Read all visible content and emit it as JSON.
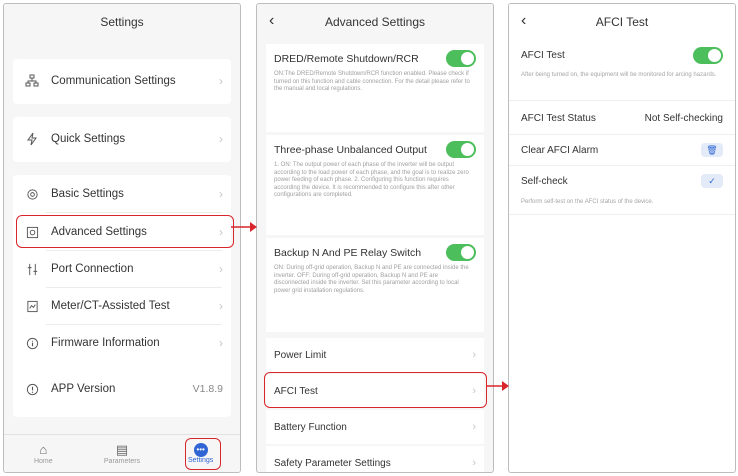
{
  "panel1": {
    "title": "Settings",
    "items": [
      {
        "label": "Communication Settings",
        "icon": "network-icon"
      },
      {
        "label": "Quick Settings",
        "icon": "lightning-icon"
      },
      {
        "label": "Basic Settings",
        "icon": "gear-icon"
      },
      {
        "label": "Advanced Settings",
        "icon": "advanced-settings-icon"
      },
      {
        "label": "Port Connection",
        "icon": "port-icon"
      },
      {
        "label": "Meter/CT-Assisted Test",
        "icon": "meter-icon"
      },
      {
        "label": "Firmware Information",
        "icon": "info-icon"
      },
      {
        "label": "APP Version",
        "icon": "app-version-icon",
        "value": "V1.8.9"
      }
    ],
    "tabs": [
      {
        "label": "Home",
        "icon": "home-icon"
      },
      {
        "label": "Parameters",
        "icon": "document-icon"
      },
      {
        "label": "Settings",
        "icon": "settings-icon"
      }
    ]
  },
  "panel2": {
    "title": "Advanced Settings",
    "options": [
      {
        "label": "DRED/Remote Shutdown/RCR",
        "desc": "ON:The DRED/Remote Shutdown/RCR function enabled. Please check if turned on this function and cable connection. For the detail please refer to the manual and local regulations.",
        "on": true
      },
      {
        "label": "Three-phase Unbalanced Output",
        "desc": "1. ON: The output power of each phase of the inverter will be output according to the load power of each phase, and the goal is to realize zero power feeding of each phase. 2. Configuring this function requires according the device. It is recommended to configure this after other configurations are completed.",
        "on": true
      },
      {
        "label": "Backup N And PE Relay Switch",
        "desc": "ON: During off-grid operation, Backup N and PE are connected inside the inverter. OFF: During off-grid operation, Backup N and PE are disconnected inside the inverter. Set this parameter according to local power grid installation regulations.",
        "on": true
      }
    ],
    "rows": [
      {
        "label": "Power Limit"
      },
      {
        "label": "AFCI Test"
      },
      {
        "label": "Battery Function"
      },
      {
        "label": "Safety Parameter Settings"
      }
    ]
  },
  "panel3": {
    "title": "AFCI Test",
    "afci_test_label": "AFCI Test",
    "afci_test_desc": "After being turned on, the equipment will be monitored for arcing hazards.",
    "status_label": "AFCI Test Status",
    "status_value": "Not Self-checking",
    "clear_label": "Clear AFCI Alarm",
    "selfcheck_label": "Self-check",
    "selfcheck_desc": "Perform self-test on the AFCI status of the device."
  },
  "colors": {
    "highlight": "#d9262a",
    "toggle_on": "#4cbe5b",
    "accent": "#2f66d4"
  }
}
